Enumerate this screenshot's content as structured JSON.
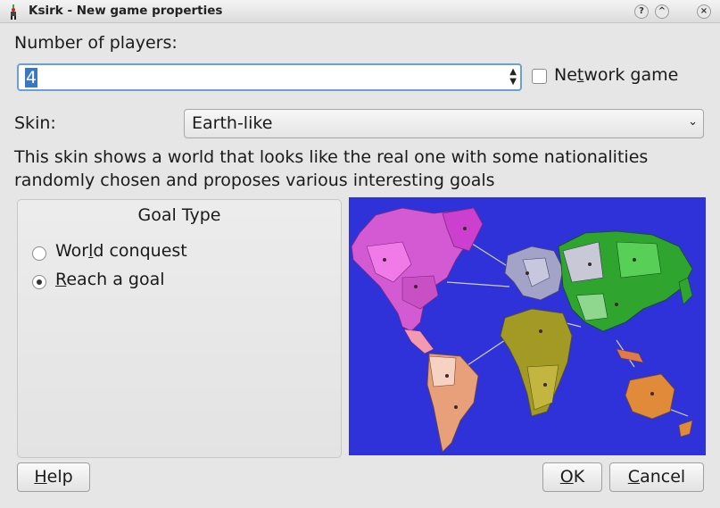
{
  "window": {
    "title": "Ksirk - New game properties",
    "buttons": [
      "?",
      "^",
      "×"
    ]
  },
  "players": {
    "label": "Number of players:",
    "value": "4"
  },
  "network": {
    "label_pre": "Ne",
    "label_mnemonic": "t",
    "label_post": "work game",
    "checked": false
  },
  "skin": {
    "label": "Skin:",
    "selected": "Earth-like",
    "description": "This skin shows a world that looks like the real one with some nationalities randomly chosen and proposes various interesting goals"
  },
  "goal": {
    "title": "Goal Type",
    "options": [
      {
        "pre": "Wor",
        "mnemonic": "l",
        "post": "d conquest",
        "checked": false
      },
      {
        "pre": "",
        "mnemonic": "R",
        "post": "each a goal",
        "checked": true
      }
    ]
  },
  "footer": {
    "help": {
      "mnemonic": "H",
      "rest": "elp"
    },
    "ok": {
      "mnemonic": "O",
      "rest": "K"
    },
    "cancel": {
      "mnemonic": "C",
      "rest": "ancel"
    }
  },
  "colors": {
    "ocean": "#2e32d8",
    "focus": "#6aa0d6",
    "selection": "#3b78c4"
  },
  "map": {
    "regions": [
      "north-america-magenta",
      "south-america-orange",
      "europe-grey",
      "africa-olive",
      "asia-green",
      "oceania-orange"
    ]
  }
}
